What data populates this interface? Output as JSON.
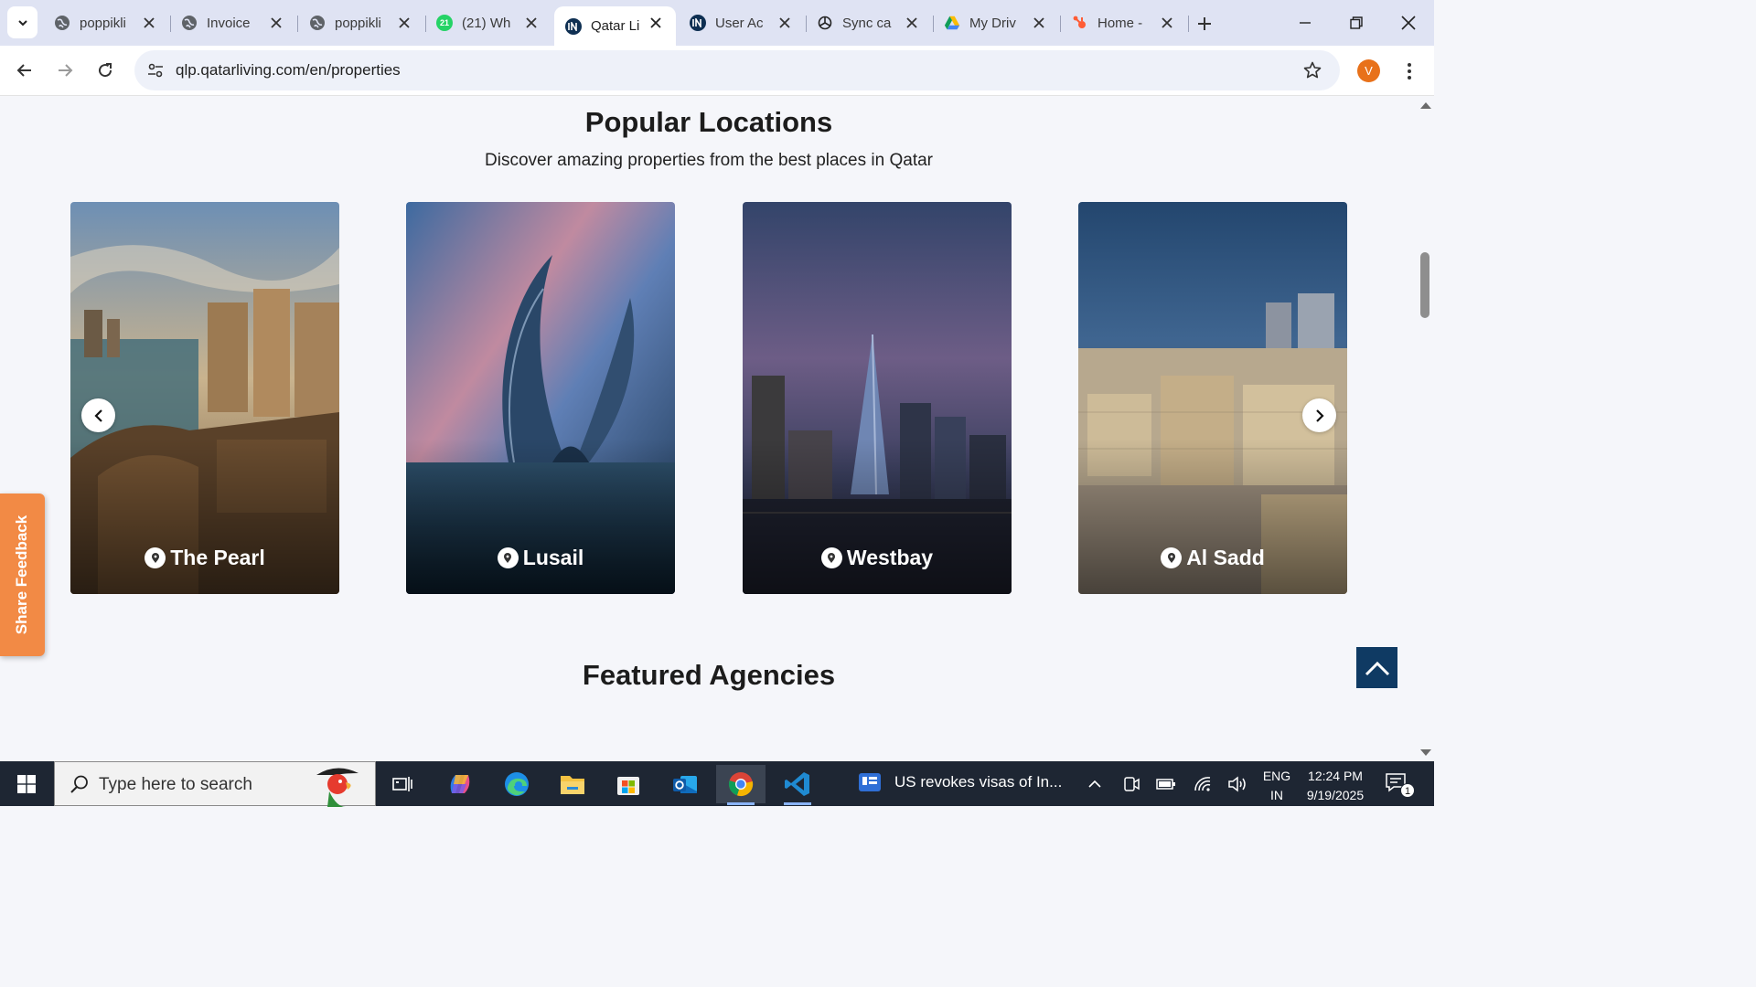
{
  "browser": {
    "tabs": [
      {
        "title": "poppikli",
        "favicon": "globe-icon"
      },
      {
        "title": "Invoice",
        "favicon": "globe-icon"
      },
      {
        "title": "poppikli",
        "favicon": "globe-icon"
      },
      {
        "title": "(21) Wh",
        "favicon": "whatsapp-icon",
        "badge": "21"
      },
      {
        "title": "Qatar Li",
        "favicon": "in-logo-icon",
        "active": true
      },
      {
        "title": "User Ac",
        "favicon": "in-logo-icon"
      },
      {
        "title": "Sync ca",
        "favicon": "openai-icon"
      },
      {
        "title": "My Driv",
        "favicon": "google-drive-icon"
      },
      {
        "title": "Home -",
        "favicon": "hubspot-icon"
      }
    ],
    "url": "qlp.qatarliving.com/en/properties",
    "profile_initial": "V"
  },
  "page": {
    "popular": {
      "title": "Popular Locations",
      "subtitle": "Discover amazing properties from the best places in Qatar",
      "locations": [
        {
          "name": "The Pearl"
        },
        {
          "name": "Lusail"
        },
        {
          "name": "Westbay"
        },
        {
          "name": "Al Sadd"
        }
      ]
    },
    "featured_title": "Featured Agencies",
    "feedback_label": "Share Feedback"
  },
  "taskbar": {
    "search_placeholder": "Type here to search",
    "news_headline": "US revokes visas of In...",
    "lang_top": "ENG",
    "lang_bottom": "IN",
    "time": "12:24 PM",
    "date": "9/19/2025",
    "notification_count": "1"
  },
  "colors": {
    "accent_orange": "#f28a45",
    "back_to_top": "#0f3a63",
    "profile": "#e8711a"
  }
}
